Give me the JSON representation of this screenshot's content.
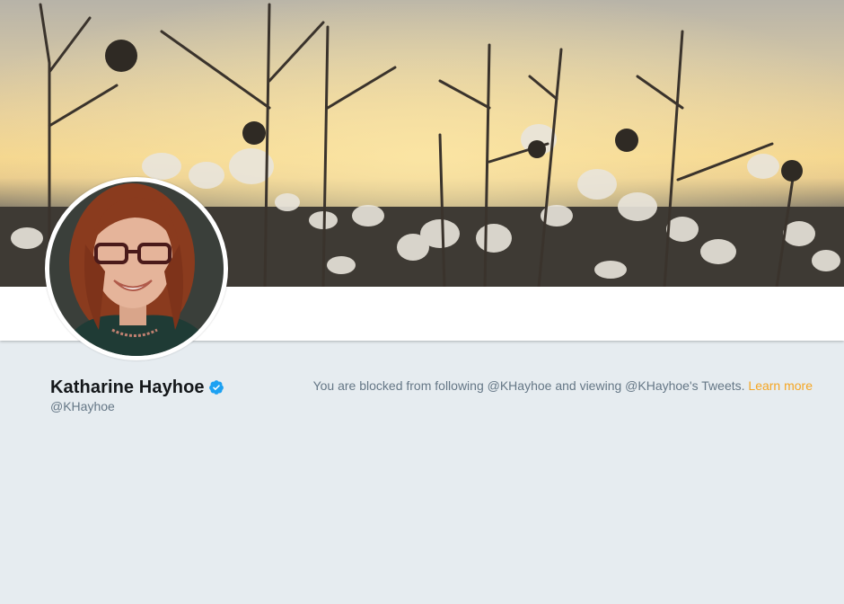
{
  "profile": {
    "name": "Katharine Hayhoe",
    "screen_name": "@KHayhoe",
    "verified_icon": "verified-badge-icon"
  },
  "notice": {
    "message": "You are blocked from following @KHayhoe and viewing @KHayhoe's Tweets.",
    "learn_more": "Learn more"
  },
  "colors": {
    "background": "#e6ecf0",
    "name_text": "#14171a",
    "secondary_text": "#657786",
    "link": "#f5a623",
    "verified": "#1da1f2"
  }
}
